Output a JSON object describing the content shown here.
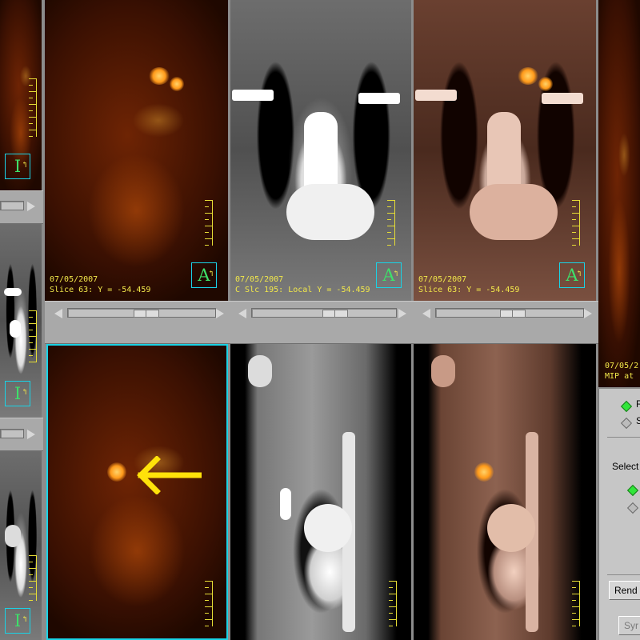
{
  "viewports": {
    "top_pet": {
      "date": "07/05/2007",
      "slice": "Slice 63: Y = -54.459",
      "orientation": "A"
    },
    "top_ct": {
      "date": "07/05/2007",
      "slice": "C Slc 195: Local Y = -54.459",
      "orientation": "A"
    },
    "top_fused": {
      "date": "07/05/2007",
      "slice": "Slice 63: Y = -54.459",
      "orientation": "A"
    },
    "mip": {
      "date": "07/05/2",
      "caption": "MIP at"
    },
    "left_top": {
      "orientation": "I"
    },
    "left_mid": {
      "orientation": "I"
    },
    "left_bot": {
      "orientation": "I"
    }
  },
  "panel": {
    "radio_1": "R",
    "radio_2": "S",
    "select_label": "Select",
    "render_button": "Rend",
    "sync_button": "Syr"
  },
  "colors": {
    "selection": "#19d3e6",
    "overlay_text": "#f2e84a",
    "arrow": "#ffe20a",
    "radio_on": "#31e63a"
  }
}
